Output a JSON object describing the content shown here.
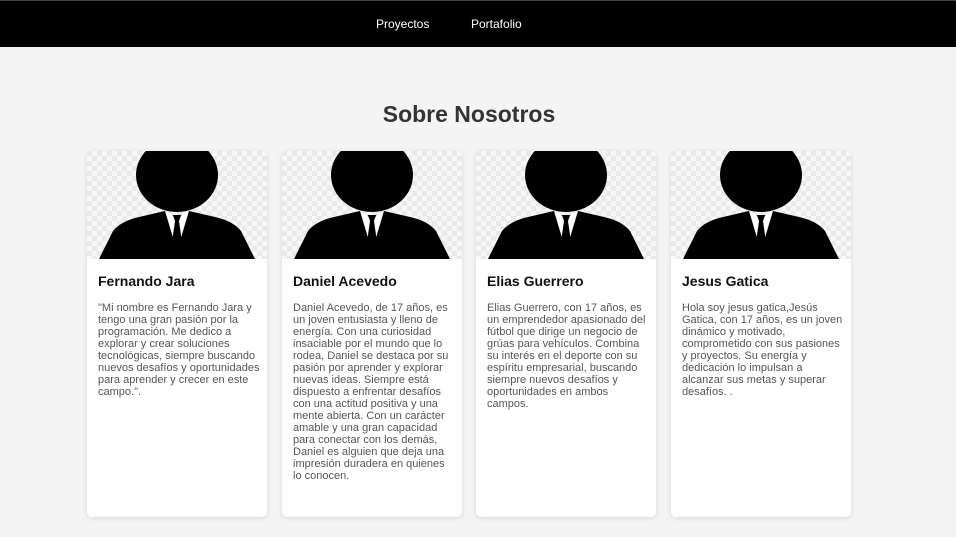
{
  "nav": {
    "items": [
      {
        "label": "Proyectos"
      },
      {
        "label": "Portafolio"
      }
    ]
  },
  "about": {
    "title": "Sobre Nosotros",
    "members": [
      {
        "name": "Fernando Jara",
        "bio": "\"Mi nombre es Fernando Jara y tengo una gran pasión por la programación. Me dedico a explorar y crear soluciones tecnológicas, siempre buscando nuevos desafíos y oportunidades para aprender y crecer en este campo.\".",
        "photo_icon": "person-silhouette-icon"
      },
      {
        "name": "Daniel Acevedo",
        "bio": "Daniel Acevedo, de 17 años, es un joven entusiasta y lleno de energía. Con una curiosidad insaciable por el mundo que lo rodea, Daniel se destaca por su pasión por aprender y explorar nuevas ideas. Siempre está dispuesto a enfrentar desafíos con una actitud positiva y una mente abierta. Con un carácter amable y una gran capacidad para conectar con los demás, Daniel es alguien que deja una impresión duradera en quienes lo conocen.",
        "photo_icon": "person-silhouette-icon"
      },
      {
        "name": "Elias Guerrero",
        "bio": "Elias Guerrero, con 17 años, es un emprendedor apasionado del fútbol que dirige un negocio de grúas para vehículos. Combina su interés en el deporte con su espíritu empresarial, buscando siempre nuevos desafíos y oportunidades en ambos campos.",
        "photo_icon": "person-silhouette-icon"
      },
      {
        "name": "Jesus Gatica",
        "bio": "Hola soy jesus gatica,Jesús Gatica, con 17 años, es un joven dinámico y motivado, comprometido con sus pasiones y proyectos. Su energía y dedicación lo impulsan a alcanzar sus metas y superar desafíos. .",
        "photo_icon": "person-silhouette-icon"
      }
    ]
  }
}
